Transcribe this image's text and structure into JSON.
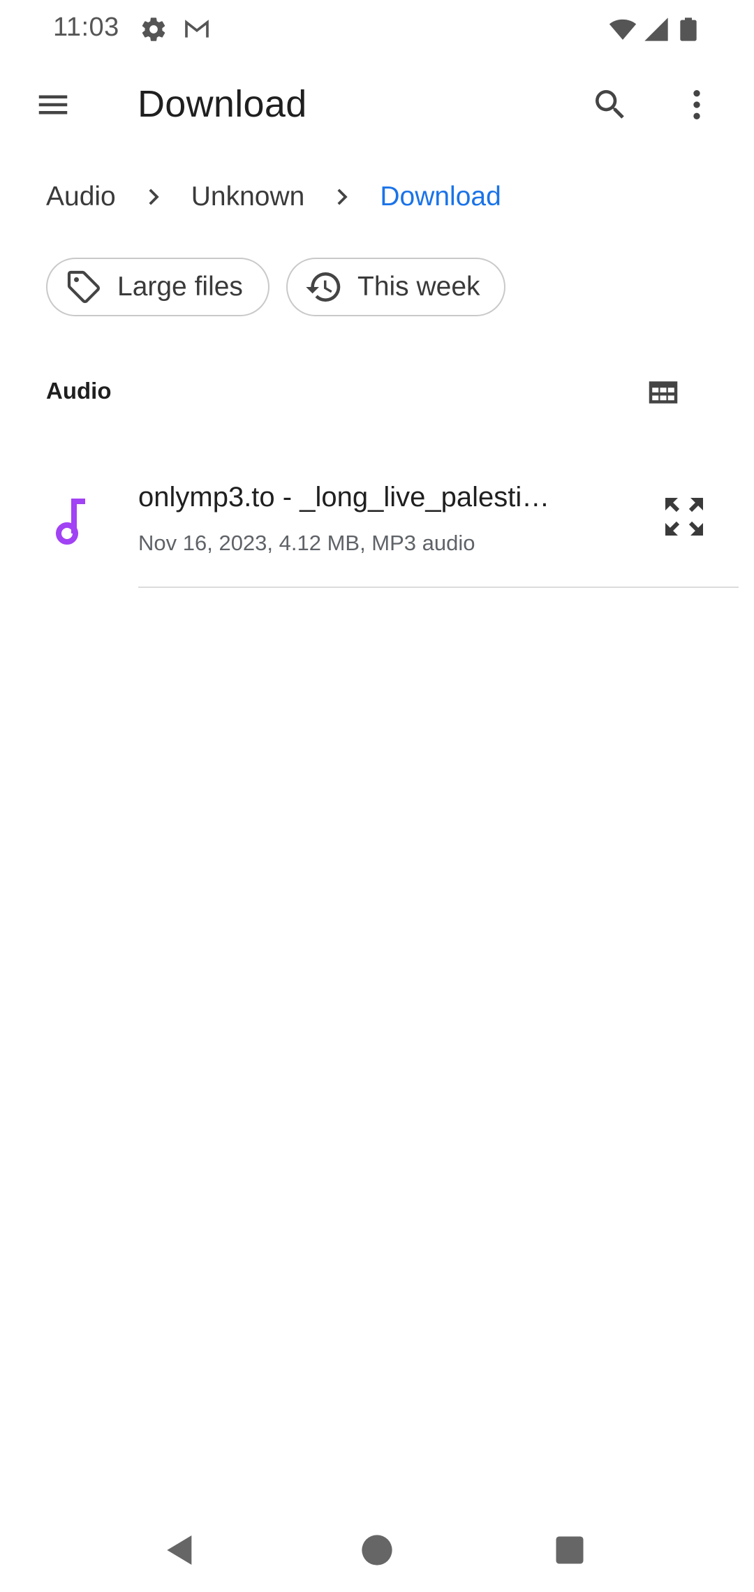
{
  "status_bar": {
    "time": "11:03",
    "icons": [
      "settings-icon",
      "gmail-icon",
      "wifi-icon",
      "signal-icon",
      "battery-icon"
    ]
  },
  "app_bar": {
    "title": "Download",
    "menu_icon": "menu-icon",
    "search_icon": "search-icon",
    "more_icon": "more-vert-icon"
  },
  "breadcrumb": {
    "items": [
      {
        "label": "Audio",
        "active": false
      },
      {
        "label": "Unknown",
        "active": false
      },
      {
        "label": "Download",
        "active": true
      }
    ]
  },
  "filters": {
    "chips": [
      {
        "label": "Large files",
        "icon": "tag-icon"
      },
      {
        "label": "This week",
        "icon": "history-icon"
      }
    ]
  },
  "section": {
    "title": "Audio",
    "view_toggle_icon": "grid-view-icon"
  },
  "files": [
    {
      "name": "onlymp3.to - _long_live_palesti…",
      "meta": "Nov 16, 2023, 4.12 MB, MP3 audio",
      "icon": "music-note-icon",
      "action_icon": "expand-icon"
    }
  ],
  "colors": {
    "accent": "#1a73e8",
    "audio_icon": "#a142f4",
    "text_primary": "#1f1f1f",
    "text_secondary": "#5f6368"
  },
  "nav_bar": {
    "icons": [
      "back-icon",
      "home-icon",
      "recents-icon"
    ]
  }
}
